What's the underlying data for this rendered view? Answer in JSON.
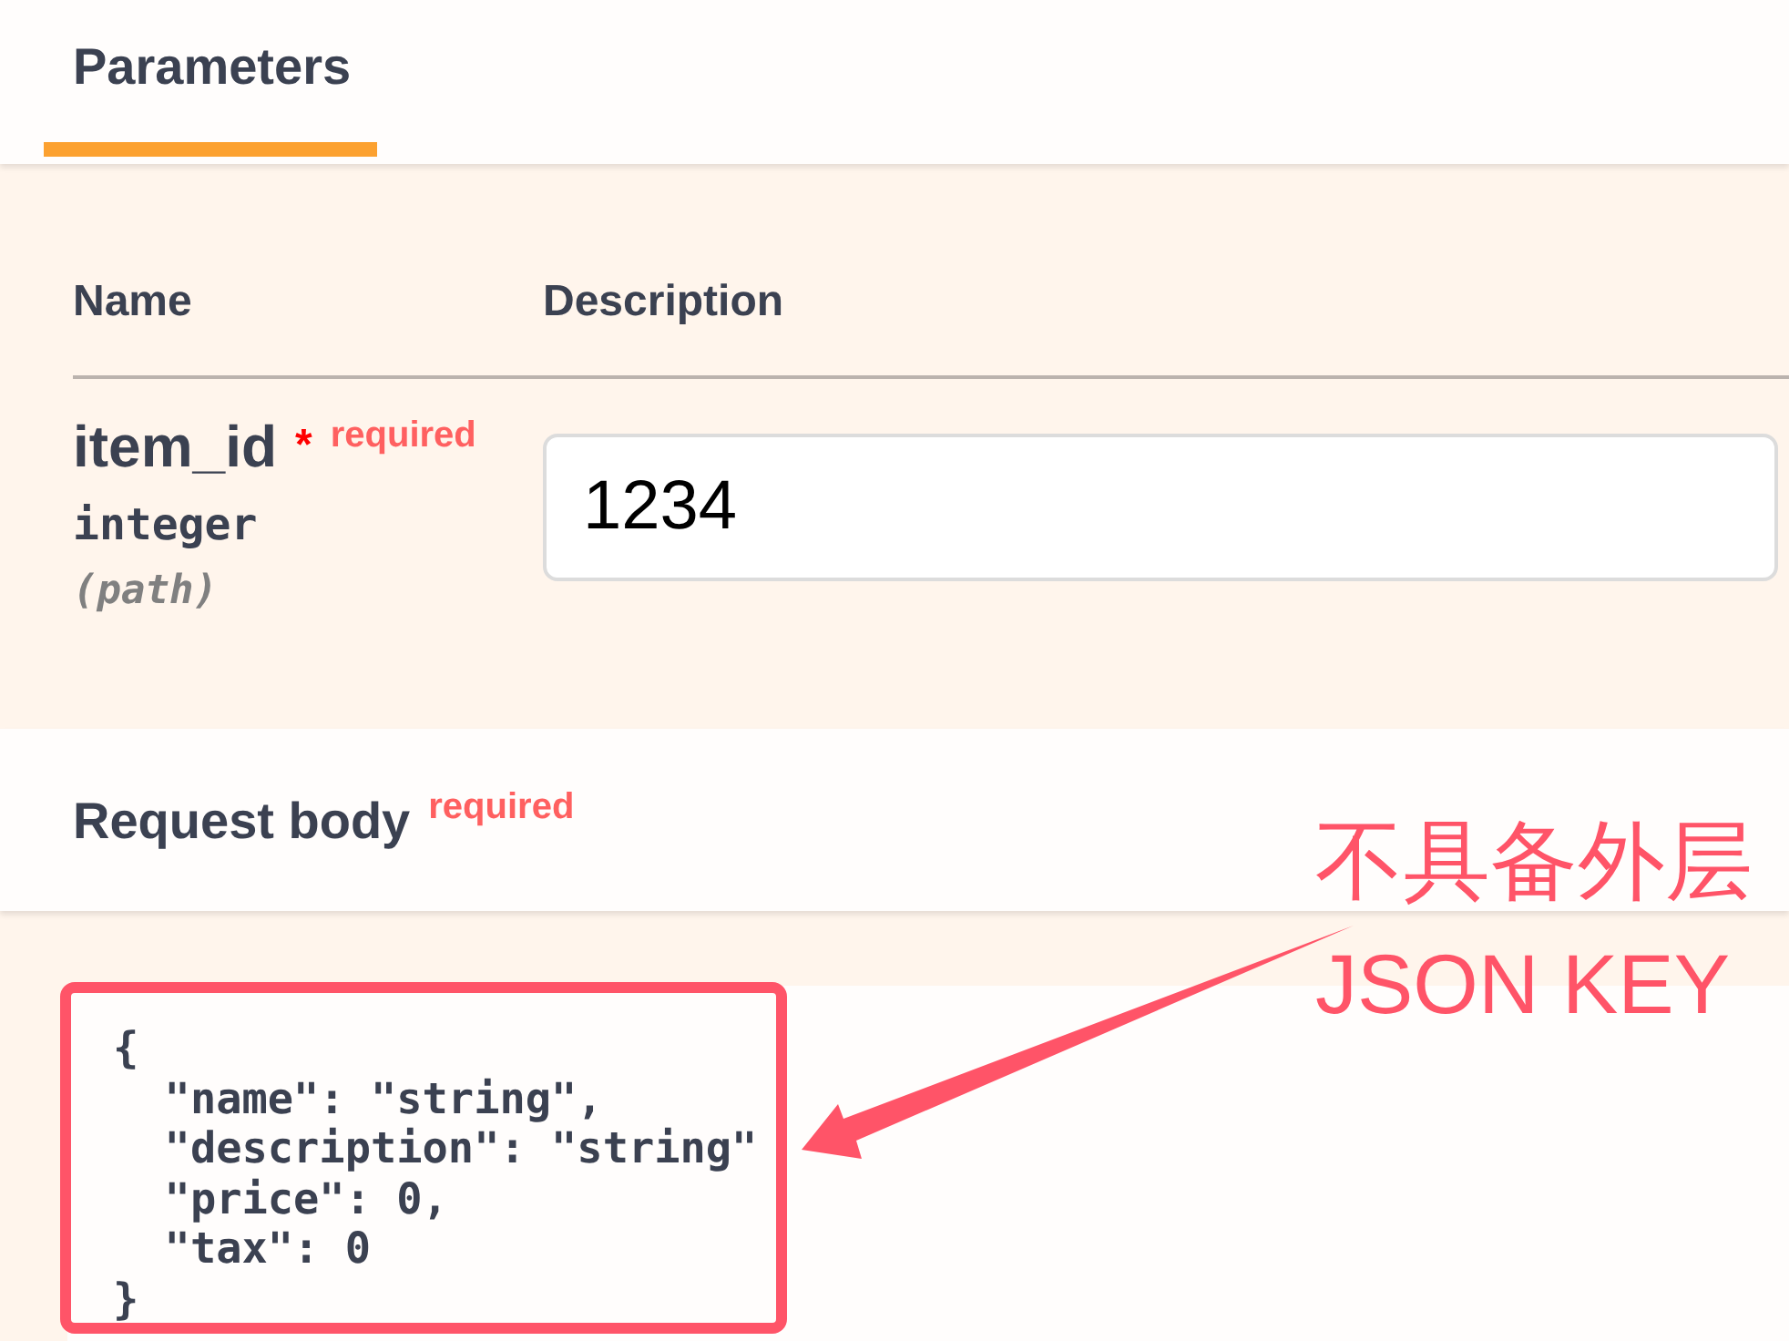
{
  "tabs": [
    {
      "label": "Parameters",
      "selected": true
    }
  ],
  "parameters": {
    "columns": [
      "Name",
      "Description"
    ],
    "rows": [
      {
        "name": "item_id",
        "required": true,
        "required_mark": "*",
        "required_label": "required",
        "type": "integer",
        "location": "(path)",
        "value": "1234"
      }
    ]
  },
  "request_body": {
    "title": "Request body",
    "required": true,
    "required_label": "required",
    "example": [
      "{",
      "  \"name\": \"string\",",
      "  \"description\": \"string\"",
      "  \"price\": 0,",
      "  \"tax\": 0",
      "}"
    ]
  },
  "annotation": {
    "lines": [
      "不具备外层",
      "JSON KEY"
    ]
  }
}
